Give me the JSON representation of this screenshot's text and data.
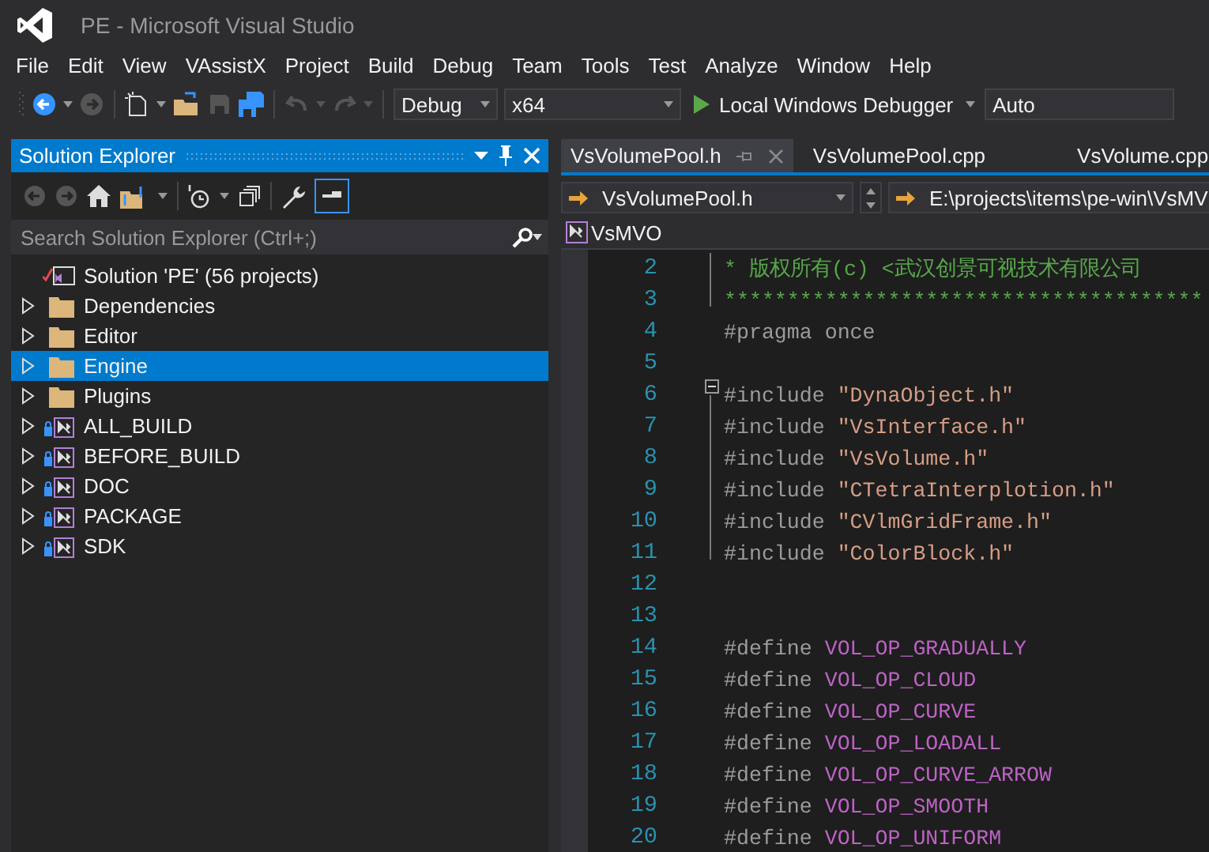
{
  "window": {
    "title": "PE - Microsoft Visual Studio"
  },
  "menu": [
    "File",
    "Edit",
    "View",
    "VAssistX",
    "Project",
    "Build",
    "Debug",
    "Team",
    "Tools",
    "Test",
    "Analyze",
    "Window",
    "Help"
  ],
  "toolbar": {
    "configuration": "Debug",
    "platform": "x64",
    "run_button": "Local Windows Debugger",
    "solution_config": "Auto"
  },
  "solution_explorer": {
    "title": "Solution Explorer",
    "search": {
      "placeholder": "Search Solution Explorer (Ctrl+;)"
    },
    "tree": [
      {
        "label": "Solution 'PE' (56 projects)",
        "kind": "solution",
        "selected": false,
        "children": [
          {
            "label": "Dependencies",
            "kind": "folder",
            "selected": false,
            "expanded": false
          },
          {
            "label": "Editor",
            "kind": "folder",
            "selected": false,
            "expanded": false
          },
          {
            "label": "Engine",
            "kind": "folder",
            "selected": true,
            "expanded": false
          },
          {
            "label": "Plugins",
            "kind": "folder",
            "selected": false,
            "expanded": false
          },
          {
            "label": "ALL_BUILD",
            "kind": "project",
            "selected": false,
            "expanded": false
          },
          {
            "label": "BEFORE_BUILD",
            "kind": "project",
            "selected": false,
            "expanded": false
          },
          {
            "label": "DOC",
            "kind": "project",
            "selected": false,
            "expanded": false
          },
          {
            "label": "PACKAGE",
            "kind": "project",
            "selected": false,
            "expanded": false
          },
          {
            "label": "SDK",
            "kind": "project",
            "selected": false,
            "expanded": false
          }
        ]
      }
    ]
  },
  "editor": {
    "tabs": [
      {
        "label": "VsVolumePool.h",
        "selected": true
      },
      {
        "label": "VsVolumePool.cpp",
        "selected": false
      },
      {
        "label": "VsVolume.cpp",
        "selected": false
      }
    ],
    "file_dropdown": "VsVolumePool.h",
    "path_dropdown": "E:\\projects\\items\\pe-win\\VsMV",
    "project_scope": "VsMVO",
    "lines": [
      {
        "number": "2",
        "tokens": [
          {
            "kind": "comment",
            "text": "* 版权所有(c) <武汉创景可视技术有限公司"
          }
        ]
      },
      {
        "number": "3",
        "tokens": [
          {
            "kind": "comment",
            "text": "**************************************"
          }
        ]
      },
      {
        "number": "4",
        "tokens": [
          {
            "kind": "directive",
            "text": "#pragma once"
          }
        ]
      },
      {
        "number": "5"
      },
      {
        "number": "6",
        "tokens": [
          {
            "kind": "directive",
            "text": "#include "
          },
          {
            "kind": "string",
            "text": "\"DynaObject.h\""
          }
        ]
      },
      {
        "number": "7",
        "tokens": [
          {
            "kind": "directive",
            "text": "#include "
          },
          {
            "kind": "string",
            "text": "\"VsInterface.h\""
          }
        ]
      },
      {
        "number": "8",
        "tokens": [
          {
            "kind": "directive",
            "text": "#include "
          },
          {
            "kind": "string",
            "text": "\"VsVolume.h\""
          }
        ]
      },
      {
        "number": "9",
        "tokens": [
          {
            "kind": "directive",
            "text": "#include "
          },
          {
            "kind": "string",
            "text": "\"CTetraInterplotion.h\""
          }
        ]
      },
      {
        "number": "10",
        "tokens": [
          {
            "kind": "directive",
            "text": "#include "
          },
          {
            "kind": "string",
            "text": "\"CVlmGridFrame.h\""
          }
        ]
      },
      {
        "number": "11",
        "tokens": [
          {
            "kind": "directive",
            "text": "#include "
          },
          {
            "kind": "string",
            "text": "\"ColorBlock.h\""
          }
        ]
      },
      {
        "number": "12"
      },
      {
        "number": "13"
      },
      {
        "number": "14",
        "tokens": [
          {
            "kind": "directive",
            "text": "#define "
          },
          {
            "kind": "macro",
            "text": "VOL_OP_GRADUALLY"
          }
        ]
      },
      {
        "number": "15",
        "tokens": [
          {
            "kind": "directive",
            "text": "#define "
          },
          {
            "kind": "macro",
            "text": "VOL_OP_CLOUD"
          }
        ]
      },
      {
        "number": "16",
        "tokens": [
          {
            "kind": "directive",
            "text": "#define "
          },
          {
            "kind": "macro",
            "text": "VOL_OP_CURVE"
          }
        ]
      },
      {
        "number": "17",
        "tokens": [
          {
            "kind": "directive",
            "text": "#define "
          },
          {
            "kind": "macro",
            "text": "VOL_OP_LOADALL"
          }
        ]
      },
      {
        "number": "18",
        "tokens": [
          {
            "kind": "directive",
            "text": "#define "
          },
          {
            "kind": "macro",
            "text": "VOL_OP_CURVE_ARROW"
          }
        ]
      },
      {
        "number": "19",
        "tokens": [
          {
            "kind": "directive",
            "text": "#define "
          },
          {
            "kind": "macro",
            "text": "VOL_OP_SMOOTH"
          }
        ]
      },
      {
        "number": "20",
        "tokens": [
          {
            "kind": "directive",
            "text": "#define "
          },
          {
            "kind": "macro",
            "text": "VOL_OP_UNIFORM"
          }
        ]
      }
    ]
  }
}
